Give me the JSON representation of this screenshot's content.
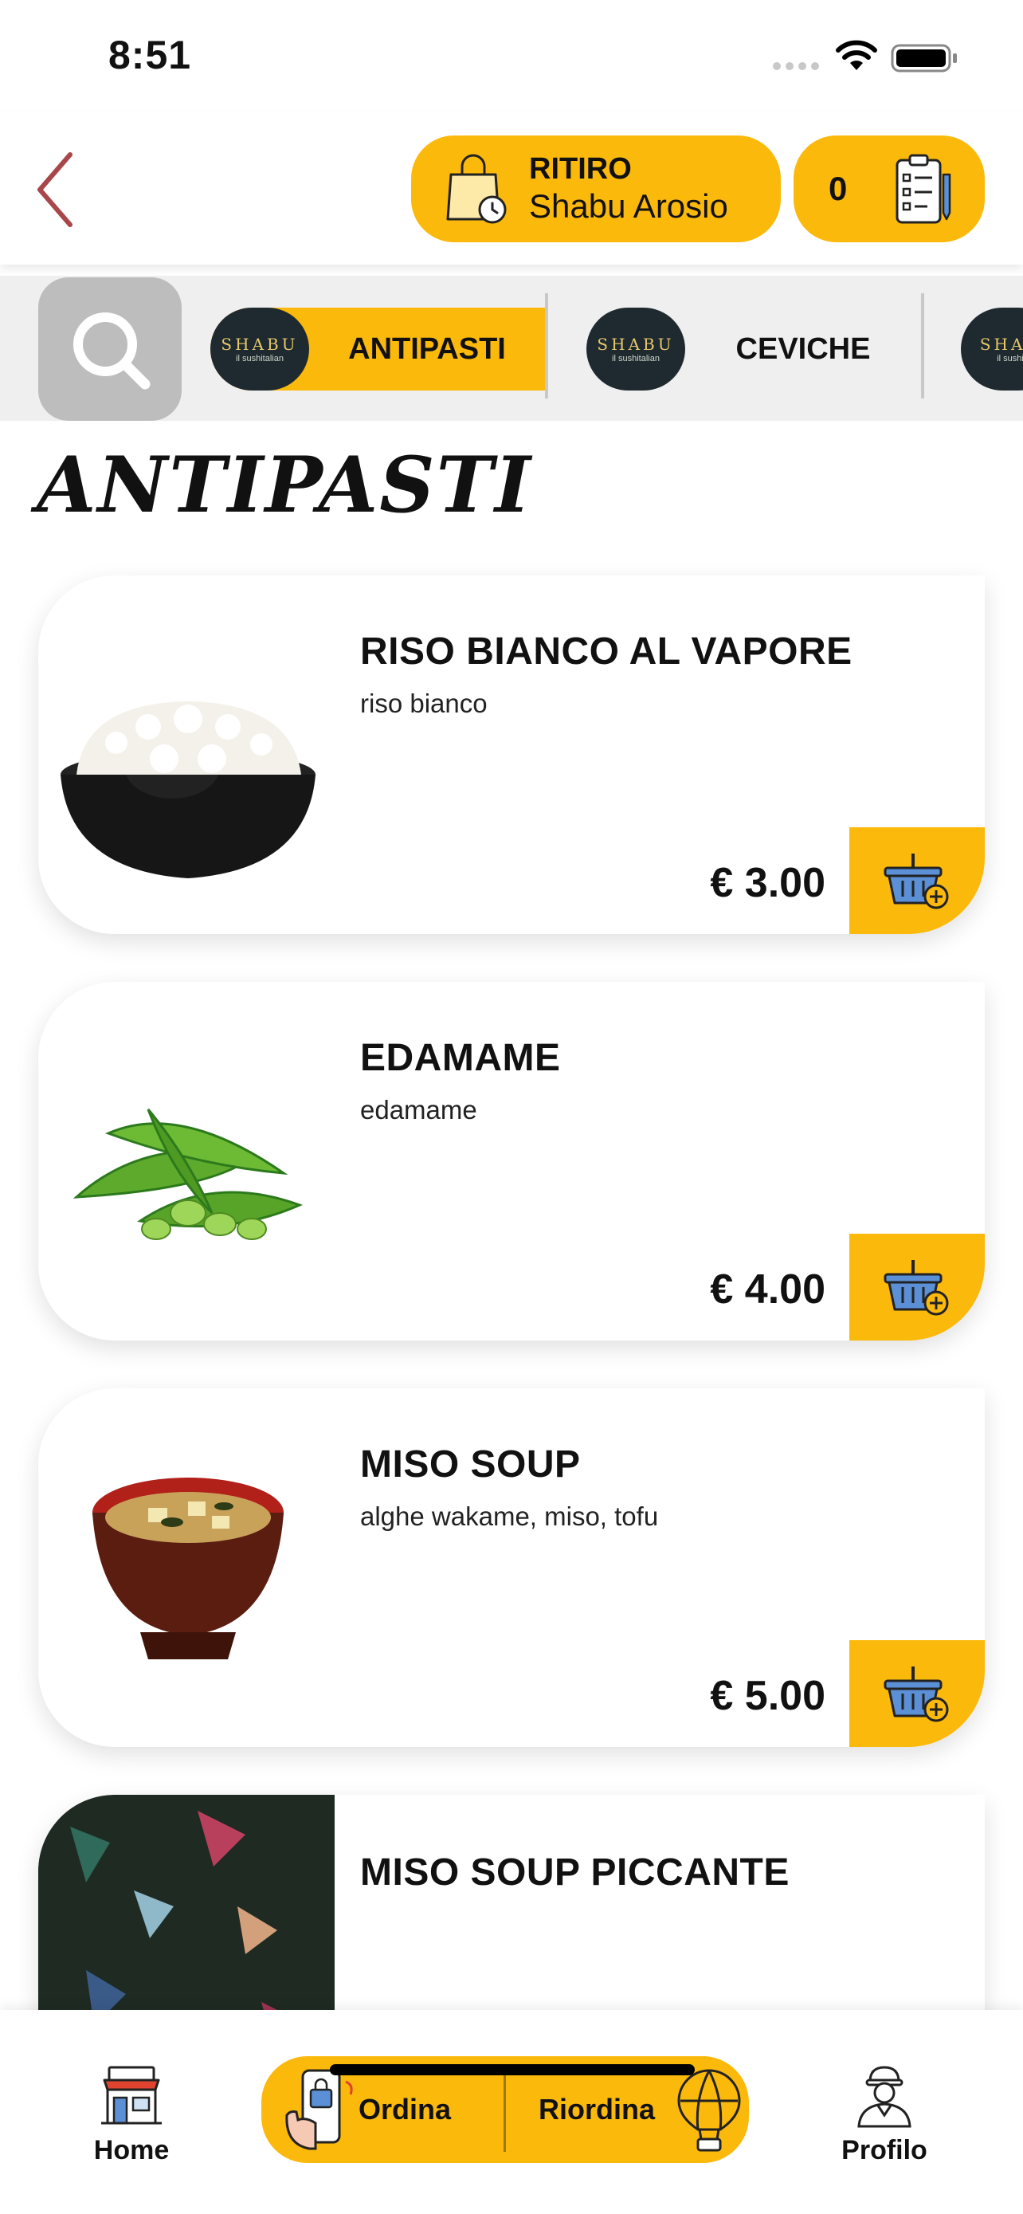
{
  "status_bar": {
    "time": "8:51"
  },
  "header": {
    "pickup": {
      "title": "RITIRO",
      "location": "Shabu Arosio"
    },
    "cart_count": "0"
  },
  "categories": [
    {
      "logo_brand": "SHABU",
      "logo_tag": "il sushitalian",
      "label": "ANTIPASTI",
      "active": true
    },
    {
      "logo_brand": "SHABU",
      "logo_tag": "il sushitalian",
      "label": "CEVICHE",
      "active": false
    },
    {
      "logo_brand": "SHAB",
      "logo_tag": "il sushi",
      "label": "",
      "active": false
    }
  ],
  "section_title": "ANTIPASTI",
  "products": [
    {
      "name": "RISO BIANCO AL VAPORE",
      "description": "riso bianco",
      "price": "€ 3.00",
      "image": "rice-bowl"
    },
    {
      "name": "EDAMAME",
      "description": "edamame",
      "price": "€ 4.00",
      "image": "edamame"
    },
    {
      "name": "MISO SOUP",
      "description": "alghe wakame, miso, tofu",
      "price": "€ 5.00",
      "image": "miso-soup"
    },
    {
      "name": "MISO SOUP PICCANTE",
      "description": "",
      "price": "",
      "image": "dark-pattern"
    }
  ],
  "bottom_nav": {
    "home": "Home",
    "order": "Ordina",
    "reorder": "Riordina",
    "profile": "Profilo"
  },
  "colors": {
    "accent": "#fbb90b",
    "back_arrow": "#a8474a",
    "basket": "#5b8fd6"
  },
  "icons": {
    "back": "chevron-left-icon",
    "pickup": "shopping-bag-clock-icon",
    "cart": "order-list-icon",
    "search": "search-icon",
    "add": "basket-plus-icon",
    "home": "store-icon",
    "order": "phone-order-icon",
    "reorder": "hot-air-balloon-icon",
    "profile": "delivery-person-icon"
  }
}
